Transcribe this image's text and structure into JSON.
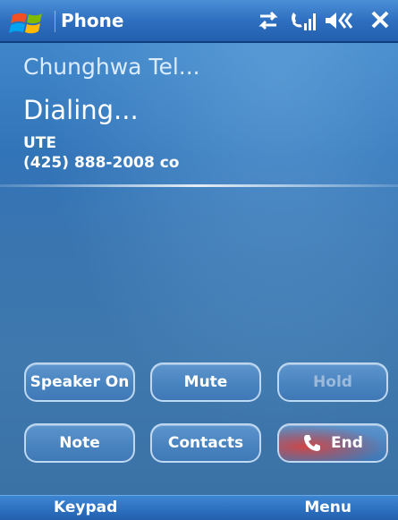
{
  "titlebar": {
    "app_title": "Phone",
    "icons": [
      "windows-start-icon",
      "connectivity-icon",
      "signal-icon",
      "volume-icon",
      "close-icon"
    ]
  },
  "call": {
    "carrier": "Chunghwa Tel...",
    "status": "Dialing...",
    "contact_name": "UTE",
    "contact_number": "(425) 888-2008 co"
  },
  "buttons": {
    "speaker": "Speaker On",
    "mute": "Mute",
    "hold": "Hold",
    "note": "Note",
    "contacts": "Contacts",
    "end": "End"
  },
  "softkeys": {
    "left": "Keypad",
    "right": "Menu"
  },
  "colors": {
    "background": "#2f6aa8",
    "titlebar": "#2e6fc0",
    "end_accent": "#e03c32",
    "disabled_text": "#9cbbdc"
  }
}
